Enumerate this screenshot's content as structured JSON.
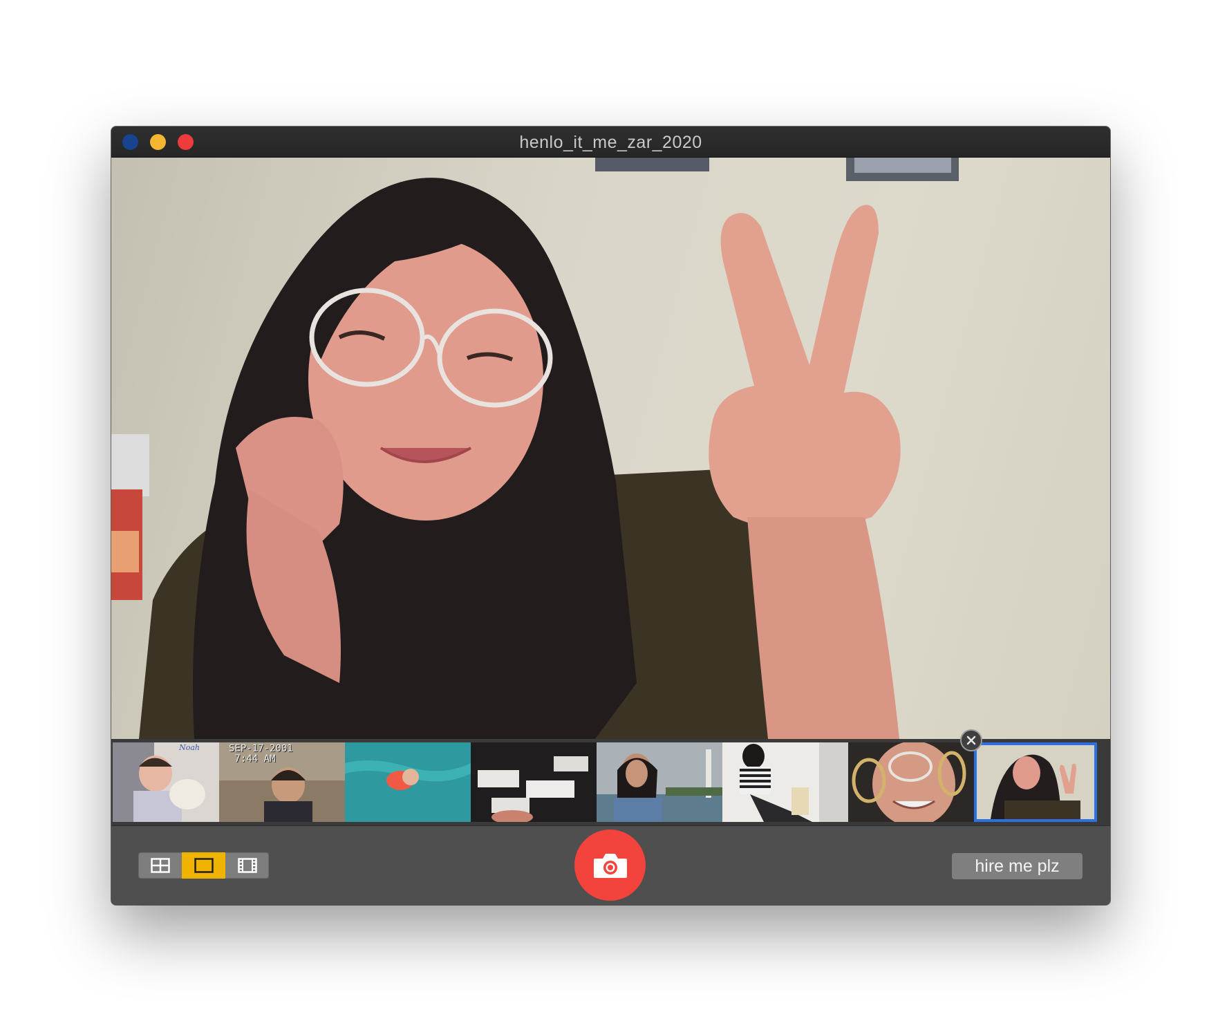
{
  "window": {
    "title": "henlo_it_me_zar_2020",
    "traffic_light_colors": [
      "#17438f",
      "#f5b731",
      "#ee3b3c"
    ]
  },
  "viewer": {
    "content": "selfie photo preview"
  },
  "filmstrip": {
    "thumbnails": [
      {
        "selected": false,
        "stamp": "",
        "scribble": "Noah"
      },
      {
        "selected": false,
        "stamp": "SEP-17-2001\n 7:44 AM",
        "scribble": ""
      },
      {
        "selected": false,
        "stamp": "",
        "scribble": ""
      },
      {
        "selected": false,
        "stamp": "",
        "scribble": ""
      },
      {
        "selected": false,
        "stamp": "",
        "scribble": ""
      },
      {
        "selected": false,
        "stamp": "",
        "scribble": ""
      },
      {
        "selected": false,
        "stamp": "",
        "scribble": ""
      },
      {
        "selected": true,
        "stamp": "",
        "scribble": ""
      }
    ],
    "remove_icon": "close-icon"
  },
  "toolbar": {
    "view_modes": [
      {
        "icon": "grid-icon",
        "active": false
      },
      {
        "icon": "single-view-icon",
        "active": true
      },
      {
        "icon": "filmstrip-icon",
        "active": false
      }
    ],
    "shutter_icon": "camera-icon",
    "hire_button_label": "hire me plz"
  },
  "colors": {
    "accent_active": "#f0b400",
    "shutter": "#f2433c",
    "selection": "#2f6fe4",
    "toolbar_bg": "#4f4f4f"
  }
}
